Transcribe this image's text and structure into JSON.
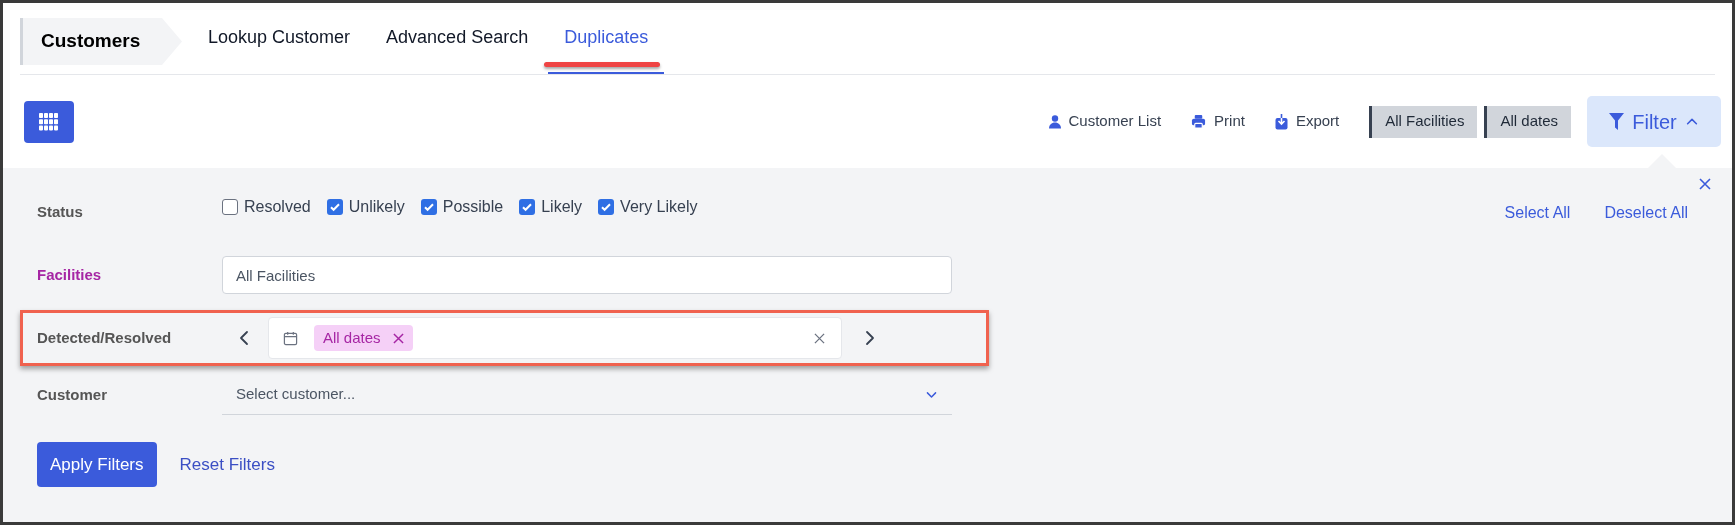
{
  "breadcrumb": "Customers",
  "tabs": [
    {
      "label": "Lookup Customer",
      "selected": false
    },
    {
      "label": "Advanced Search",
      "selected": false
    },
    {
      "label": "Duplicates",
      "selected": true
    }
  ],
  "toolbar": {
    "actions": [
      {
        "kind": "person",
        "label": "Customer List"
      },
      {
        "kind": "printer",
        "label": "Print"
      },
      {
        "kind": "download",
        "label": "Export"
      }
    ],
    "chips": [
      "All Facilities",
      "All dates"
    ],
    "filter_button": {
      "label": "Filter",
      "expanded": true
    }
  },
  "filter_panel": {
    "status": {
      "label": "Status",
      "options": [
        {
          "label": "Resolved",
          "checked": false
        },
        {
          "label": "Unlikely",
          "checked": true
        },
        {
          "label": "Possible",
          "checked": true
        },
        {
          "label": "Likely",
          "checked": true
        },
        {
          "label": "Very Likely",
          "checked": true
        }
      ]
    },
    "select_all": "Select All",
    "deselect_all": "Deselect All",
    "facilities": {
      "label": "Facilities",
      "placeholder": "All Facilities"
    },
    "date_range": {
      "label": "Detected/Resolved",
      "tag": "All dates"
    },
    "customer": {
      "label": "Customer",
      "placeholder": "Select customer..."
    },
    "apply": "Apply Filters",
    "reset": "Reset Filters"
  }
}
